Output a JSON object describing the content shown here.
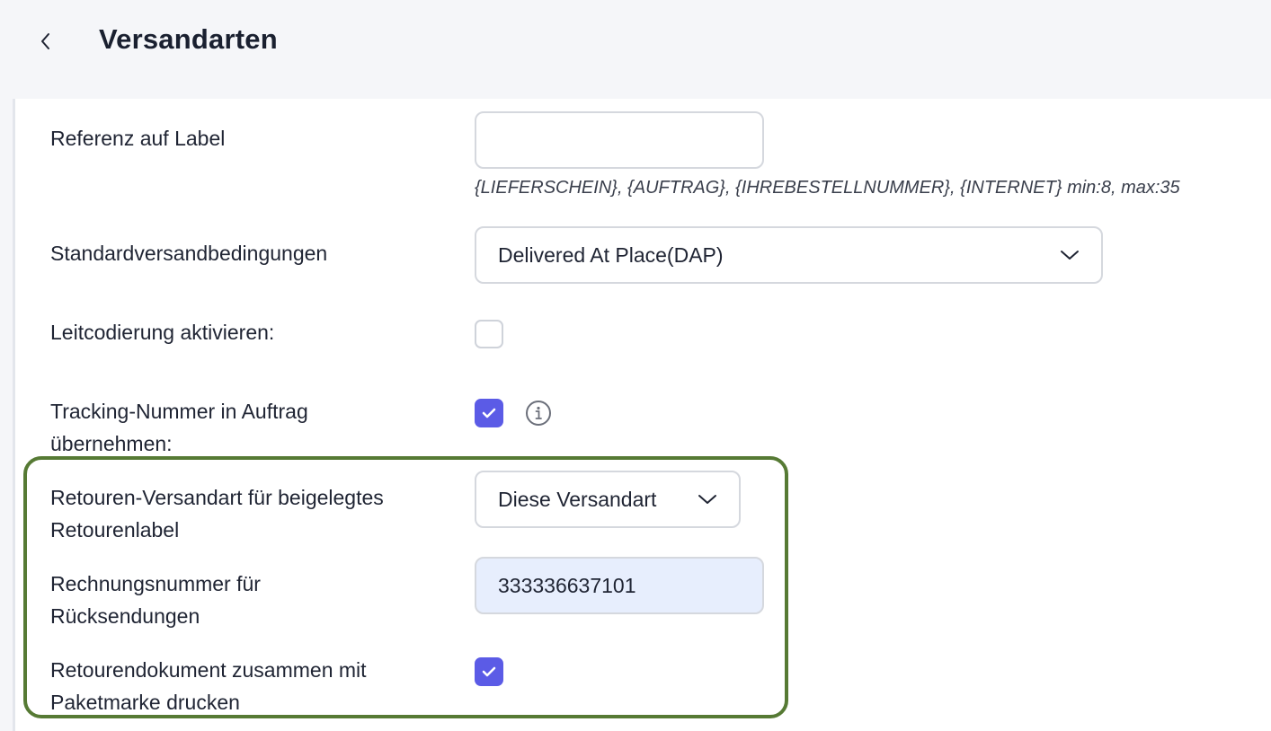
{
  "header": {
    "title": "Versandarten",
    "back_icon": "chevron-left-icon"
  },
  "form": {
    "reference": {
      "label": "Referenz auf Label",
      "value": "",
      "hint": "{LIEFERSCHEIN}, {AUFTRAG}, {IHREBESTELLNUMMER}, {INTERNET} min:8, max:35"
    },
    "shipping_terms": {
      "label": "Standardversandbedingungen",
      "selected": "Delivered At Place(DAP)"
    },
    "routing_code": {
      "label": "Leitcodierung aktivieren:",
      "checked": false
    },
    "tracking": {
      "label_line1": "Tracking-Nummer in Auftrag",
      "label_line2": "übernehmen:",
      "checked": true,
      "info_icon": "info-icon"
    },
    "return_method": {
      "label_line1": "Retouren-Versandart für beigelegtes",
      "label_line2": "Retourenlabel",
      "selected": "Diese Versandart"
    },
    "invoice_number": {
      "label_line1": "Rechnungsnummer für",
      "label_line2": "Rücksendungen",
      "value": "333336637101"
    },
    "return_document": {
      "label_line1": "Retourendokument zusammen mit",
      "label_line2": "Paketmarke drucken",
      "checked": true
    }
  },
  "colors": {
    "accent": "#5b5be6",
    "highlight_border": "#567a34",
    "filled_input_bg": "#e7eefd"
  }
}
